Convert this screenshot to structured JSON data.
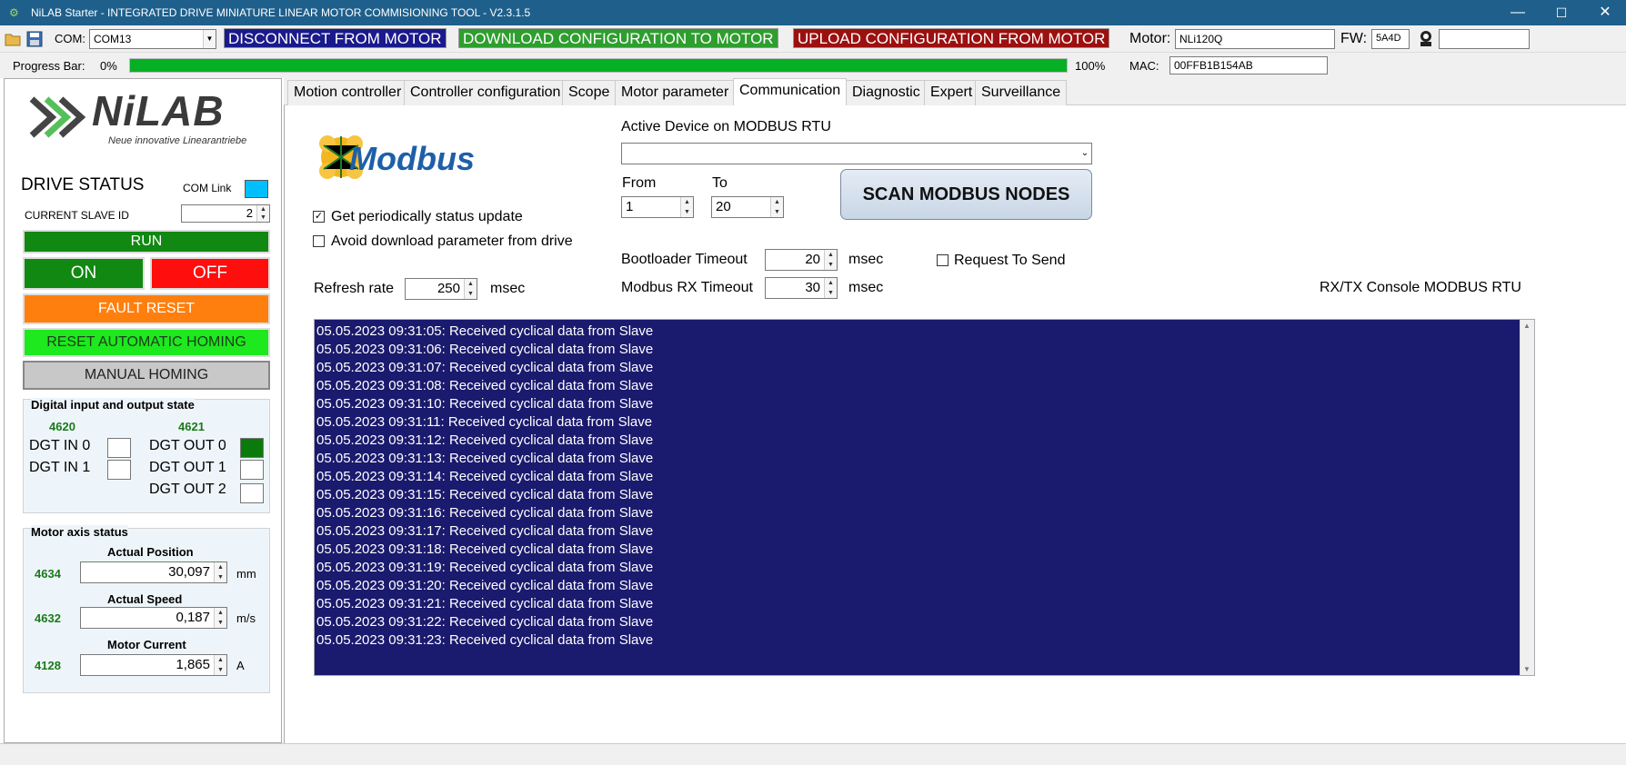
{
  "window": {
    "title": "NiLAB Starter - INTEGRATED DRIVE MINIATURE LINEAR MOTOR COMMISIONING TOOL - V2.3.1.5",
    "minimize": "—",
    "maximize": "☐",
    "close": "✕"
  },
  "toolbar": {
    "com_label": "COM:",
    "com_value": "COM13",
    "disconnect_label": "DISCONNECT FROM MOTOR",
    "download_label": "DOWNLOAD CONFIGURATION TO MOTOR",
    "upload_label": "UPLOAD CONFIGURATION FROM MOTOR",
    "motor_label": "Motor:",
    "motor_value": "NLi120Q",
    "fw_label": "FW:",
    "fw_value": "5A4D",
    "extra_value": "",
    "colors": {
      "disconnect": "#1a1a8c",
      "download": "#2e9e2e",
      "upload": "#9c1010"
    }
  },
  "progress": {
    "label": "Progress Bar:",
    "start": "0%",
    "end": "100%",
    "fraction": 1.0,
    "mac_label": "MAC:",
    "mac_value": "00FFB1B154AB"
  },
  "left": {
    "logo_text": "NiLAB",
    "logo_sub": "Neue innovative Linearantriebe",
    "drive_status": "DRIVE STATUS",
    "com_link": "COM Link",
    "slave_id_label": "CURRENT SLAVE ID",
    "slave_id": "2",
    "run": "RUN",
    "on": "ON",
    "off": "OFF",
    "fault_reset": "FAULT RESET",
    "reset_homing": "RESET AUTOMATIC HOMING",
    "manual_homing": "MANUAL HOMING",
    "dio": {
      "title": "Digital input and output state",
      "in_num": "4620",
      "out_num": "4621",
      "in0": "DGT IN 0",
      "in1": "DGT IN 1",
      "out0": "DGT OUT 0",
      "out1": "DGT OUT 1",
      "out2": "DGT OUT 2"
    },
    "axis": {
      "title": "Motor axis status",
      "pos_label": "Actual Position",
      "pos_num": "4634",
      "pos_value": "30,097",
      "pos_unit": "mm",
      "speed_label": "Actual Speed",
      "speed_num": "4632",
      "speed_value": "0,187",
      "speed_unit": "m/s",
      "current_label": "Motor Current",
      "current_num": "4128",
      "current_value": "1,865",
      "current_unit": "A"
    }
  },
  "tabs": [
    "Motion controller",
    "Controller configuration",
    "Scope",
    "Motor parameter",
    "Communication",
    "Diagnostic",
    "Expert",
    "Surveillance"
  ],
  "comm": {
    "modbus_logo": "Modbus",
    "active_device_label": "Active Device on MODBUS RTU",
    "active_device_value": "",
    "from_label": "From",
    "from_value": "1",
    "to_label": "To",
    "to_value": "20",
    "scan_button": "SCAN MODBUS NODES",
    "get_status": "Get periodically status update",
    "avoid_download": "Avoid download parameter from drive",
    "bootloader_label": "Bootloader Timeout",
    "bootloader_value": "20",
    "rx_timeout_label": "Modbus RX Timeout",
    "rx_timeout_value": "30",
    "msec": "msec",
    "request_to_send": "Request To Send",
    "refresh_label": "Refresh rate",
    "refresh_value": "250",
    "console_title": "RX/TX Console MODBUS RTU",
    "console_lines": [
      "05.05.2023 09:31:05: Received cyclical data from Slave",
      "05.05.2023 09:31:06: Received cyclical data from Slave",
      "05.05.2023 09:31:07: Received cyclical data from Slave",
      "05.05.2023 09:31:08: Received cyclical data from Slave",
      "05.05.2023 09:31:10: Received cyclical data from Slave",
      "05.05.2023 09:31:11: Received cyclical data from Slave",
      "05.05.2023 09:31:12: Received cyclical data from Slave",
      "05.05.2023 09:31:13: Received cyclical data from Slave",
      "05.05.2023 09:31:14: Received cyclical data from Slave",
      "05.05.2023 09:31:15: Received cyclical data from Slave",
      "05.05.2023 09:31:16: Received cyclical data from Slave",
      "05.05.2023 09:31:17: Received cyclical data from Slave",
      "05.05.2023 09:31:18: Received cyclical data from Slave",
      "05.05.2023 09:31:19: Received cyclical data from Slave",
      "05.05.2023 09:31:20: Received cyclical data from Slave",
      "05.05.2023 09:31:21: Received cyclical data from Slave",
      "05.05.2023 09:31:22: Received cyclical data from Slave",
      "05.05.2023 09:31:23: Received cyclical data from Slave"
    ]
  }
}
